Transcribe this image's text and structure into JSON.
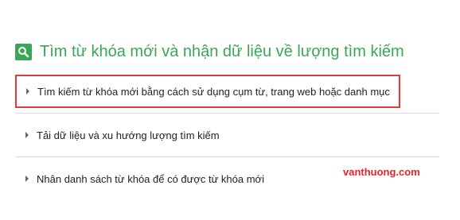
{
  "header": {
    "icon": "search-icon",
    "title": "Tìm từ khóa mới và nhận dữ liệu về lượng tìm kiếm"
  },
  "options": [
    {
      "label": "Tìm kiếm từ khóa mới bằng cách sử dụng cụm từ, trang web hoặc danh mục",
      "icon": "caret-right-icon",
      "highlighted": true
    },
    {
      "label": "Tải dữ liệu và xu hướng lượng tìm kiếm",
      "icon": "caret-right-icon"
    },
    {
      "label": "Nhân danh sách từ khóa để có được từ khóa mới",
      "icon": "caret-right-icon"
    }
  ],
  "watermark": "vanthuong.com",
  "colors": {
    "accent": "#3aa757",
    "highlight_border": "#e03a3a",
    "watermark": "#e8232a"
  }
}
